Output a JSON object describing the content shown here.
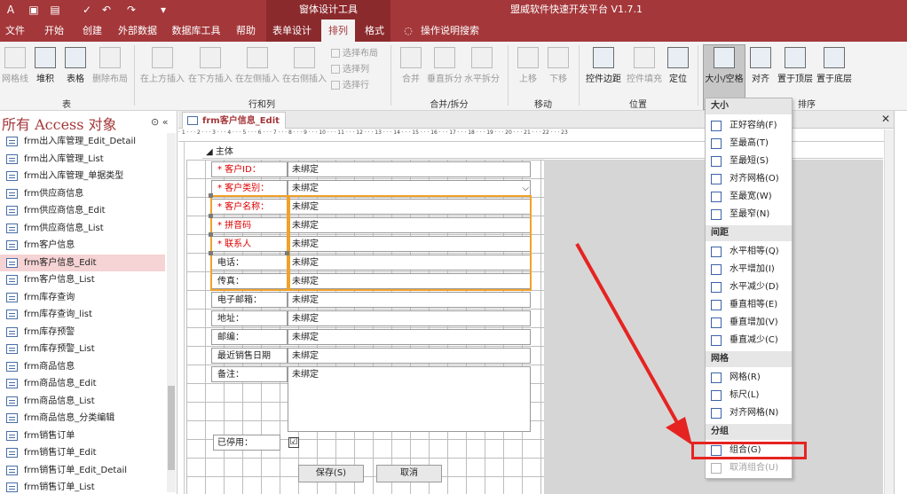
{
  "title_bar": {
    "context_title": "窗体设计工具",
    "app_title": "盟威软件快速开发平台 V1.7.1"
  },
  "menu": {
    "tabs": [
      "文件",
      "开始",
      "创建",
      "外部数据",
      "数据库工具",
      "帮助",
      "表单设计",
      "排列",
      "格式"
    ],
    "help_search": "操作说明搜索",
    "active": "排列"
  },
  "ribbon": {
    "table_group": {
      "label": "表",
      "buttons": [
        "网格线",
        "堆积",
        "表格",
        "删除布局"
      ]
    },
    "rows_cols_group": {
      "label": "行和列",
      "buttons": [
        "在上方插入",
        "在下方插入",
        "在左侧插入",
        "在右侧插入"
      ],
      "small": [
        "选择布局",
        "选择列",
        "选择行"
      ]
    },
    "merge_group": {
      "label": "合并/拆分",
      "buttons": [
        "合并",
        "垂直拆分",
        "水平拆分"
      ]
    },
    "move_group": {
      "label": "移动",
      "buttons": [
        "上移",
        "下移"
      ]
    },
    "position_group": {
      "label": "位置",
      "buttons": [
        "控件边距",
        "控件填充",
        "定位"
      ]
    },
    "size_group": {
      "label": "大小/空格",
      "partial_label": "排序",
      "buttons": [
        "大小/空格",
        "对齐",
        "置于顶层",
        "置于底层"
      ]
    }
  },
  "nav": {
    "title": "所有 Access 对象",
    "items": [
      "frm出入库管理_Edit_Detail",
      "frm出入库管理_List",
      "frm出入库管理_单据类型",
      "frm供应商信息",
      "frm供应商信息_Edit",
      "frm供应商信息_List",
      "frm客户信息",
      "frm客户信息_Edit",
      "frm客户信息_List",
      "frm库存查询",
      "frm库存查询_list",
      "frm库存预警",
      "frm库存预警_List",
      "frm商品信息",
      "frm商品信息_Edit",
      "frm商品信息_List",
      "frm商品信息_分类编辑",
      "frm销售订单",
      "frm销售订单_Edit",
      "frm销售订单_Edit_Detail",
      "frm销售订单_List"
    ],
    "selected": "frm客户信息_Edit"
  },
  "doc": {
    "tab": "frm客户信息_Edit",
    "section": "主体",
    "ruler": "· 1 · · · 2 · · · 3 · · · 4 · · · 5 · · · 6 · · · 7 · · · 8 · · · 9 · · · 10 · · · 11 · · · 12 · · · 13 · · · 14 · · · 15 · · · 16 · · · 17 · · · 18 · · · 19 · · · 20 · · · 21 · · · 22 · · · 23"
  },
  "form": {
    "fields": [
      {
        "label": "* 客户ID：",
        "value": "未绑定"
      },
      {
        "label": "* 客户类别：",
        "value": "未绑定"
      },
      {
        "label": "* 客户名称：",
        "value": "未绑定"
      },
      {
        "label": "* 拼音码",
        "value": "未绑定"
      },
      {
        "label": "* 联系人",
        "value": "未绑定"
      },
      {
        "label": "电话：",
        "value": "未绑定"
      },
      {
        "label": "传真：",
        "value": "未绑定"
      },
      {
        "label": "电子邮箱：",
        "value": "未绑定"
      },
      {
        "label": "地址：",
        "value": "未绑定"
      },
      {
        "label": "邮编：",
        "value": "未绑定"
      },
      {
        "label": "最近销售日期",
        "value": "未绑定"
      },
      {
        "label": "备注：",
        "value": "未绑定"
      }
    ],
    "disabled_label": "已停用：",
    "checkbox": "☑",
    "save_button": "保存(S)",
    "cancel_button": "取消"
  },
  "dropdown": {
    "size_header": "大小",
    "size_items": [
      "正好容纳(F)",
      "至最高(T)",
      "至最短(S)",
      "对齐网格(O)",
      "至最宽(W)",
      "至最窄(N)"
    ],
    "spacing_header": "间距",
    "spacing_items": [
      "水平相等(Q)",
      "水平增加(I)",
      "水平减少(D)",
      "垂直相等(E)",
      "垂直增加(V)",
      "垂直减少(C)"
    ],
    "grid_header": "网格",
    "grid_items": [
      "网格(R)",
      "标尺(L)",
      "对齐网格(N)"
    ],
    "group_header": "分组",
    "group_items": [
      "组合(G)",
      "取消组合(U)"
    ]
  },
  "colors": {
    "accent": "#a4373a",
    "highlight": "#e52421",
    "selection": "#f0a22b"
  }
}
